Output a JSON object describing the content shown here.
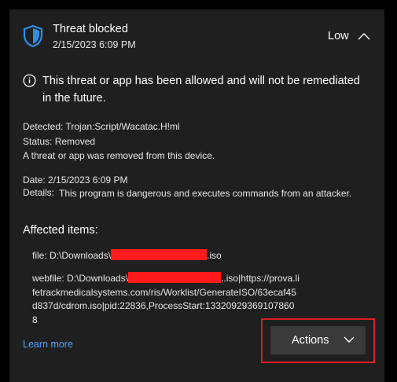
{
  "header": {
    "title": "Threat blocked",
    "datetime": "2/15/2023 6:09 PM",
    "severity": "Low"
  },
  "notice": "This threat or app has been allowed and will not be remediated in the future.",
  "detected": {
    "label": "Detected:",
    "value": "Trojan:Script/Wacatac.H!ml"
  },
  "status": {
    "label": "Status:",
    "value": "Removed"
  },
  "removed_description": "A threat or app was removed from this device.",
  "date": {
    "label": "Date:",
    "value": "2/15/2023 6:09 PM"
  },
  "details": {
    "label": "Details:",
    "value": "This program is dangerous and executes commands from an attacker."
  },
  "affected_items": {
    "heading": "Affected items:",
    "file": {
      "prefix": "file: D:\\Downloads\\",
      "suffix": ".iso"
    },
    "webfile": {
      "prefix": "webfile: D:\\Downloads\\",
      "suffix": "..iso|https://prova.lifetrackmedicalsystems.com/ris/Worklist/GenerateISO/63ecaf45d837d/cdrom.iso|pid:22836,ProcessStart:133209293691078608"
    }
  },
  "learn_more": "Learn more",
  "actions_button": "Actions",
  "colors": {
    "panel_bg": "#1f1f1f",
    "accent_link": "#4ea4ff",
    "shield": "#2f8fe6",
    "redaction": "#ff1b1b",
    "highlight_border": "#e21c21"
  },
  "icons": {
    "shield": "shield-icon",
    "info": "info-icon",
    "collapse": "chevron-up-icon",
    "dropdown": "chevron-down-icon"
  }
}
